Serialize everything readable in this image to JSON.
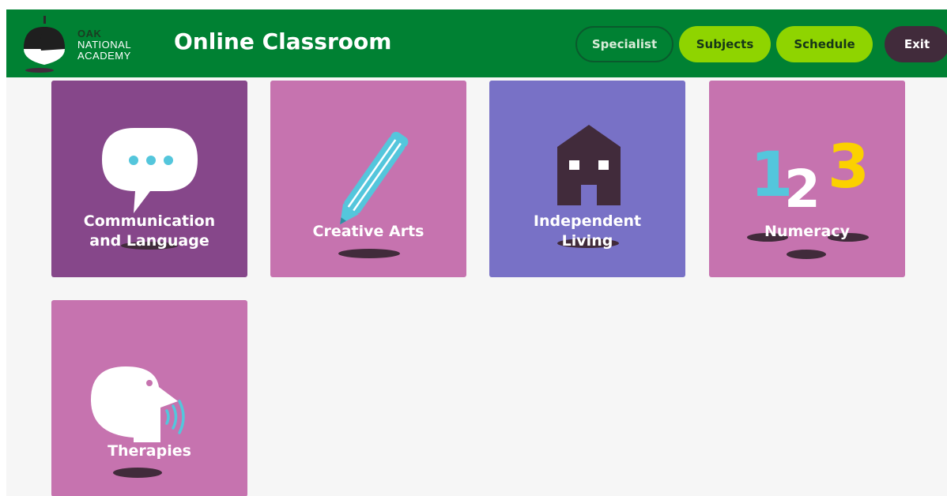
{
  "header": {
    "logo": {
      "line1": "OAK",
      "line2": "NATIONAL",
      "line3": "ACADEMY",
      "icon": "acorn-icon"
    },
    "title": "Online Classroom",
    "nav": {
      "specialist": "Specialist",
      "subjects": "Subjects",
      "schedule": "Schedule",
      "exit": "Exit"
    }
  },
  "colors": {
    "header_bg": "#008133",
    "accent_green": "#8fd400",
    "dark_plum": "#412b3b",
    "tile_purple": "#86478a",
    "tile_pink": "#c673af",
    "tile_violet": "#7871c6",
    "cyan": "#54c6dc",
    "yellow": "#fbd100"
  },
  "subjects": [
    {
      "label_line1": "Communication",
      "label_line2": "and Language",
      "icon": "speech-bubble-icon"
    },
    {
      "label_line1": "Creative Arts",
      "icon": "pencil-icon"
    },
    {
      "label_line1": "Independent",
      "label_line2": "Living",
      "icon": "house-icon"
    },
    {
      "label_line1": "Numeracy",
      "icon": "numbers-123-icon",
      "digits": [
        "1",
        "2",
        "3"
      ]
    },
    {
      "label_line1": "Therapies",
      "icon": "speaking-head-icon"
    }
  ]
}
